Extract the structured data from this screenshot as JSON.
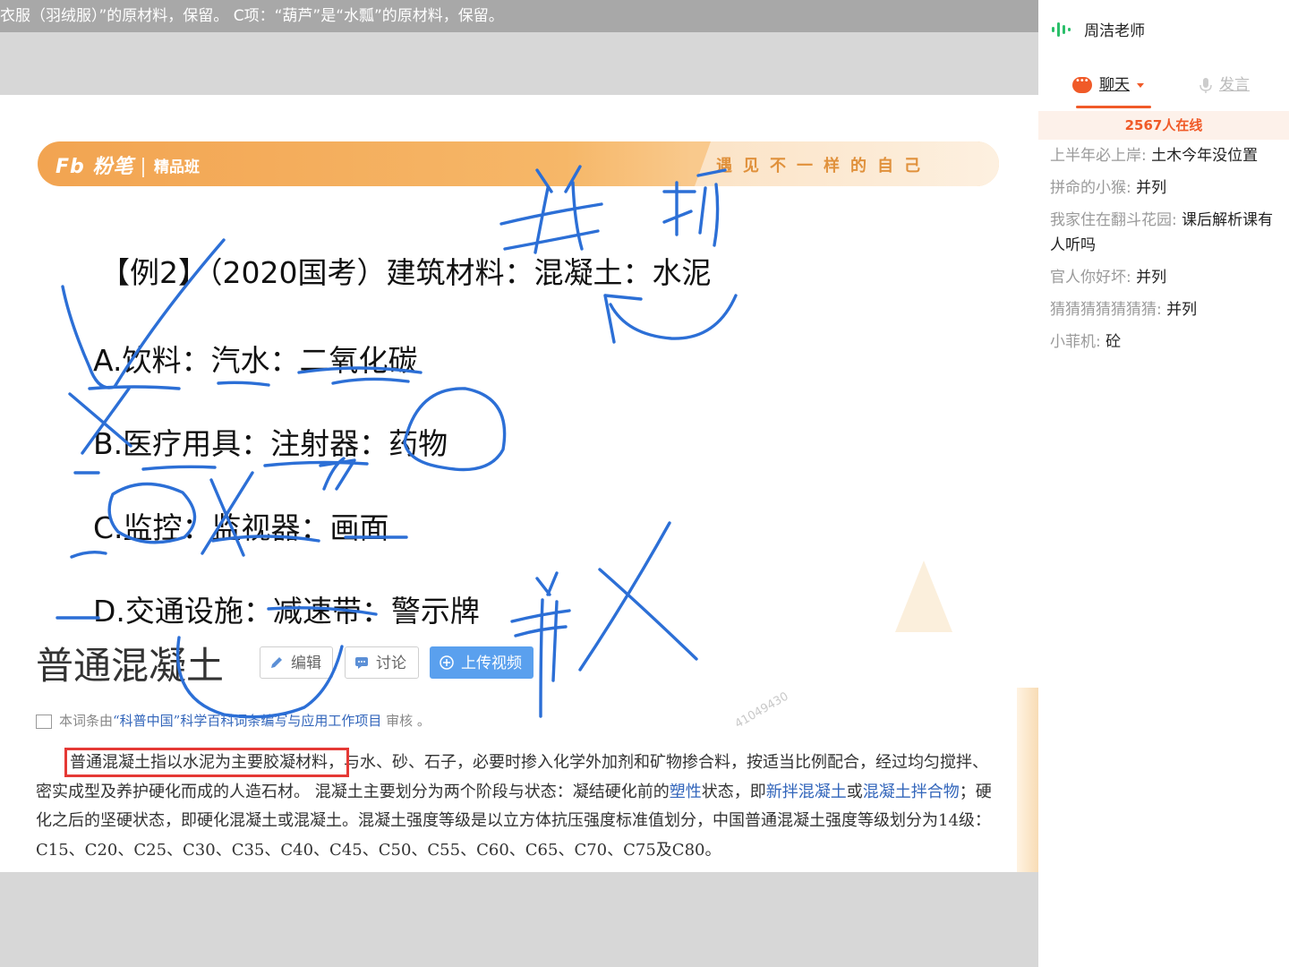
{
  "topbar": {
    "text": "衣服（羽绒服）”的原材料，保留。 C项：“葫芦”是“水瓢”的原材料，保留。"
  },
  "banner": {
    "logo": "粉笔",
    "course": "精品班",
    "slogan": "遇见不一样的自己"
  },
  "question": {
    "title": "【例2】（2020国考）建筑材料：混凝土：水泥",
    "options": [
      "A.饮料：汽水：二氧化碳",
      "B.医疗用具：注射器：药物",
      "C.监控：监视器：画面",
      "D.交通设施：减速带：警示牌"
    ]
  },
  "encyclopedia": {
    "title": "普通混凝土",
    "buttons": {
      "edit": "编辑",
      "discuss": "讨论",
      "upload": "上传视频"
    },
    "watermark": "41049430",
    "review": {
      "prefix": "本词条由",
      "source": "“科普中国”科学百科词条编写与应用工作项目",
      "suffix": " 审核 。"
    },
    "paragraph": {
      "highlight": "普通混凝土指以水泥为主要胶凝材料，",
      "text1": "与水、砂、石子，必要时掺入化学外加剂和矿物掺合料，按适当比例配合，经过均匀搅拌、密实成型及养护硬化而成的人造石材。 混凝土主要划分为两个阶段与状态：凝结硬化前的",
      "link1": "塑性",
      "text2": "状态，即",
      "link2": "新拌混凝土",
      "text3": "或",
      "link3": "混凝土拌合物",
      "text4": "；硬化之后的坚硬状态，即硬化混凝土或混凝土。混凝土强度等级是以立方体抗压强度标准值划分，中国普通混凝土强度等级划分为14级：C15、C20、C25、C30、C35、C40、C45、C50、C55、C60、C65、C70、C75及C80。"
    }
  },
  "panel": {
    "teacher": "周洁老师",
    "tabs": {
      "chat": "聊天",
      "speak": "发言"
    },
    "online": "2567人在线",
    "messages": [
      {
        "user": "上半年必上岸:",
        "text": " 土木今年没位置"
      },
      {
        "user": "拼命的小猴:",
        "text": " 并列"
      },
      {
        "user": "我家住在翻斗花园:",
        "text": " 课后解析课有人听吗"
      },
      {
        "user": "官人你好坏:",
        "text": " 并列"
      },
      {
        "user": "猜猜猜猜猜猜猜:",
        "text": " 并列"
      },
      {
        "user": "小菲机:",
        "text": " 砼"
      }
    ]
  },
  "colors": {
    "accent": "#f05a28",
    "ink": "#2c6fd6",
    "banner": "#f2a451",
    "link": "#3366bb",
    "highlight_box": "#e53935"
  }
}
